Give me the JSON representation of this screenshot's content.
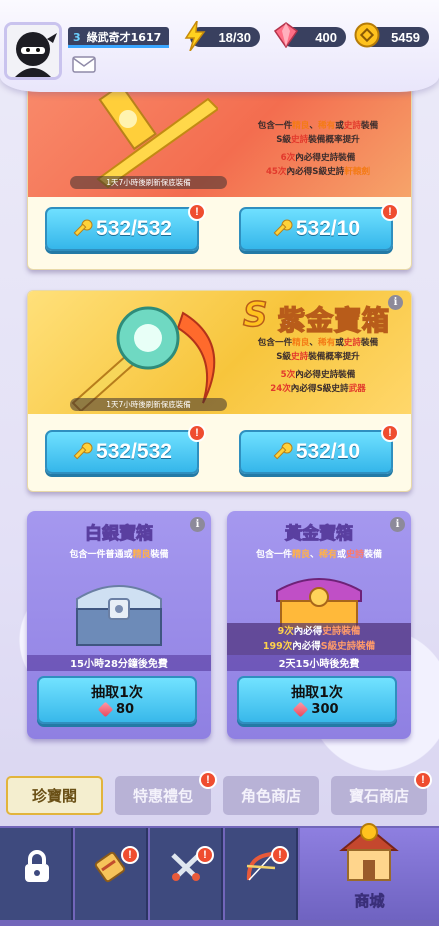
{
  "player": {
    "level": "3",
    "name": "綠武奇才1617"
  },
  "resources": {
    "energy": "18/30",
    "gems": "400",
    "coins": "5459"
  },
  "chest_top": {
    "title_fragment": "",
    "desc_line1": [
      "包含一件",
      "精良",
      "、",
      "稀有",
      "或",
      "史詩",
      "裝備"
    ],
    "desc_line2": [
      "S級",
      "史詩",
      "裝備概率提升"
    ],
    "guarantee1": [
      "6次",
      "內必得史詩裝備"
    ],
    "guarantee2": [
      "45次",
      "內必得S級史詩",
      "軒轅劍"
    ],
    "refresh_timer": "1天7小時後刷新保底裝備",
    "btn_single": "532/532",
    "btn_ten": "532/10",
    "badge": "!"
  },
  "chest_purple_gold": {
    "title": "紫金寶箱",
    "s_mark": "S",
    "desc_line1": [
      "包含一件",
      "精良",
      "、",
      "稀有",
      "或",
      "史詩",
      "裝備"
    ],
    "desc_line2": [
      "S級",
      "史詩",
      "裝備概率提升"
    ],
    "guarantee1": [
      "5次",
      "內必得史詩裝備"
    ],
    "guarantee2": [
      "24次",
      "內必得S級史詩",
      "武器"
    ],
    "refresh_timer": "1天7小時後刷新保底裝備",
    "btn_single": "532/532",
    "btn_ten": "532/10",
    "badge": "!"
  },
  "chest_silver": {
    "title": "白銀寶箱",
    "desc": [
      "包含一件普通或",
      "精良",
      "裝備"
    ],
    "free_timer": "15小時28分鐘後免費",
    "draw_label": "抽取1次",
    "cost": "80"
  },
  "chest_gold": {
    "title": "黃金寶箱",
    "desc": [
      "包含一件",
      "精良",
      "、",
      "稀有",
      "或",
      "史詩",
      "裝備"
    ],
    "guarantee1": [
      "9次",
      "內必得",
      "史詩裝備"
    ],
    "guarantee2": [
      "199次",
      "內必得",
      "S級史詩裝備"
    ],
    "free_timer": "2天15小時後免費",
    "draw_label": "抽取1次",
    "cost": "300"
  },
  "tabs": [
    {
      "label": "珍寶閣",
      "active": true
    },
    {
      "label": "特惠禮包",
      "badge": "!"
    },
    {
      "label": "角色商店"
    },
    {
      "label": "寶石商店",
      "badge": "!"
    }
  ],
  "nav": {
    "shop_label": "商城",
    "badge": "!"
  },
  "colors": {
    "accent_blue": "#38b8ea",
    "badge_red": "#ef4d30",
    "purple": "#7266ba"
  }
}
